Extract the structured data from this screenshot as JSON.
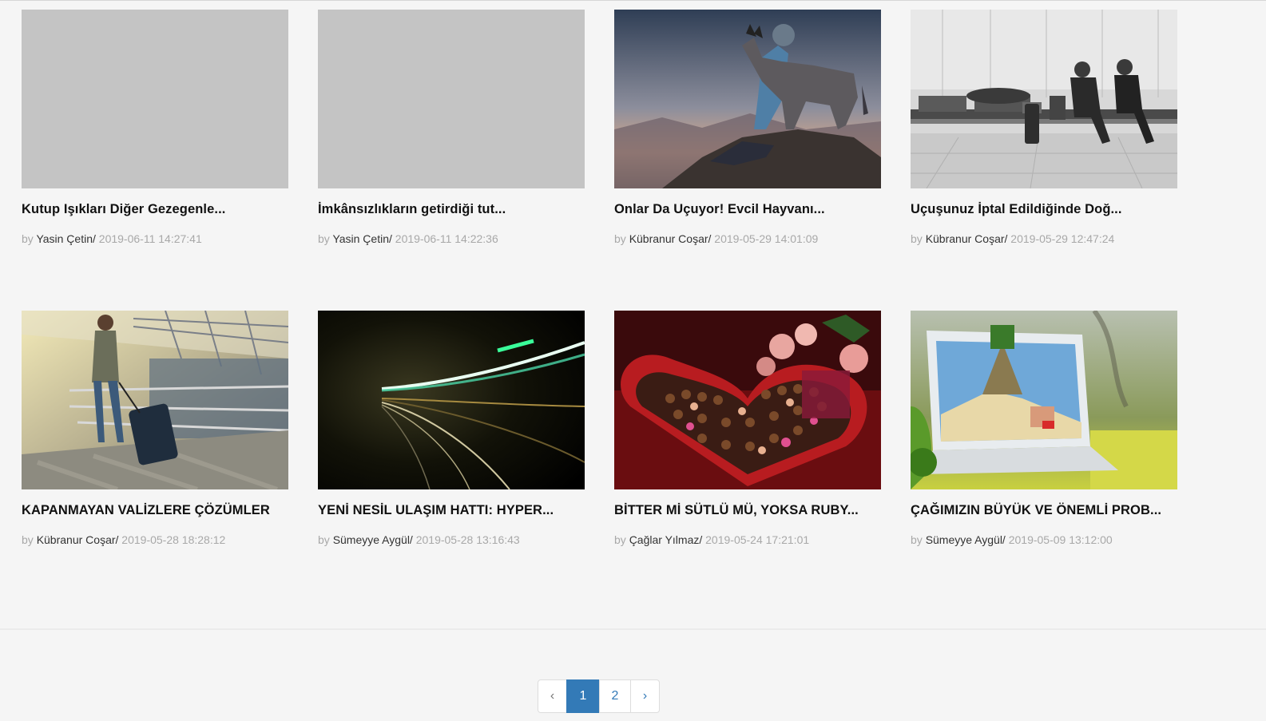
{
  "articles": [
    {
      "title": "Kutup Işıkları Diğer Gezegenle...",
      "by": "by",
      "author": "Yasin Çetin/",
      "date": "2019-06-11 14:27:41",
      "image": "placeholder"
    },
    {
      "title": "İmkânsızlıkların getirdiği tut...",
      "by": "by",
      "author": "Yasin Çetin/",
      "date": "2019-06-11 14:22:36",
      "image": "placeholder"
    },
    {
      "title": "Onlar Da Uçuyor! Evcil Hayvanı...",
      "by": "by",
      "author": "Kübranur Coşar/",
      "date": "2019-05-29 14:01:09",
      "image": "person-with-dog-on-mountain"
    },
    {
      "title": "Uçuşunuz İptal Edildiğinde Doğ...",
      "by": "by",
      "author": "Kübranur Coşar/",
      "date": "2019-05-29 12:47:24",
      "image": "travelers-sleeping-in-airport"
    },
    {
      "title": "KAPANMAYAN VALİZLERE ÇÖZÜMLER",
      "by": "by",
      "author": "Kübranur Coşar/",
      "date": "2019-05-28 18:28:12",
      "image": "woman-with-suitcase"
    },
    {
      "title": "YENİ NESİL ULAŞIM HATTI: HYPER...",
      "by": "by",
      "author": "Sümeyye Aygül/",
      "date": "2019-05-28 13:16:43",
      "image": "light-trails-tunnel"
    },
    {
      "title": "BİTTER Mİ SÜTLÜ MÜ, YOKSA RUBY...",
      "by": "by",
      "author": "Çağlar Yılmaz/",
      "date": "2019-05-24 17:21:01",
      "image": "heart-chocolate-box"
    },
    {
      "title": "ÇAĞIMIZIN BÜYÜK VE ÖNEMLİ PROB...",
      "by": "by",
      "author": "Sümeyye Aygül/",
      "date": "2019-05-09 13:12:00",
      "image": "laptop-game-in-grass"
    }
  ],
  "pagination": {
    "prev": "‹",
    "pages": [
      "1",
      "2"
    ],
    "current": "1",
    "next": "›"
  },
  "colors": {
    "background": "#f5f5f5",
    "accent": "#337ab7",
    "meta_gray": "#a8a8a8",
    "placeholder": "#c4c4c4"
  }
}
